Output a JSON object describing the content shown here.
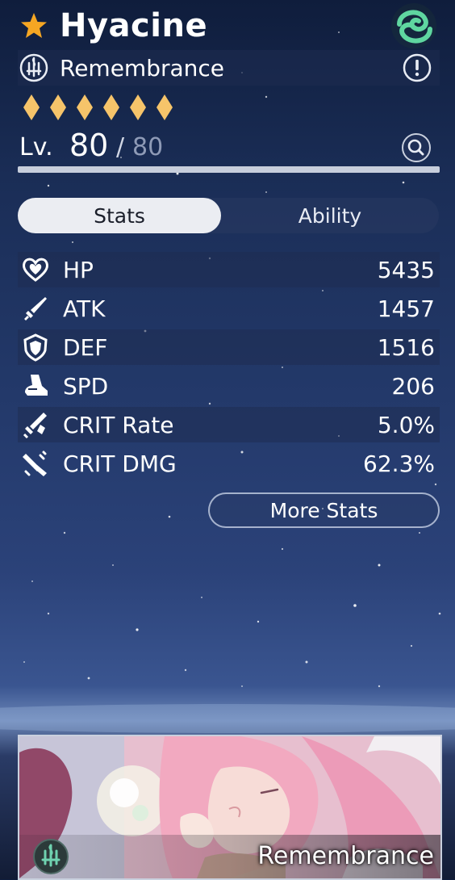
{
  "character": {
    "name": "Hyacine",
    "path": "Remembrance",
    "rarity": 6,
    "level_label": "Lv.",
    "level_current": "80",
    "level_separator": "/",
    "level_max": "80",
    "level_progress": 1.0
  },
  "icons": {
    "rarity_star": "star-icon",
    "element": "wind-element-icon",
    "path": "remembrance-path-icon",
    "info": "info-icon",
    "zoom": "zoom-icon",
    "rarity_diamond": "diamond-icon"
  },
  "tabs": [
    {
      "label": "Stats",
      "active": true
    },
    {
      "label": "Ability",
      "active": false
    }
  ],
  "stats": [
    {
      "icon": "heart-icon",
      "label": "HP",
      "value": "5435"
    },
    {
      "icon": "sword-icon",
      "label": "ATK",
      "value": "1457"
    },
    {
      "icon": "shield-icon",
      "label": "DEF",
      "value": "1516"
    },
    {
      "icon": "boot-icon",
      "label": "SPD",
      "value": "206"
    },
    {
      "icon": "crit-rate-icon",
      "label": "CRIT Rate",
      "value": "5.0%"
    },
    {
      "icon": "crit-dmg-icon",
      "label": "CRIT DMG",
      "value": "62.3%"
    }
  ],
  "more_stats_label": "More Stats",
  "card": {
    "path_label": "Remembrance"
  },
  "colors": {
    "star": "#f5a623",
    "diamond": "#f6c46a",
    "element": "#5fd6a0",
    "active_tab_bg": "#ebedf2"
  }
}
